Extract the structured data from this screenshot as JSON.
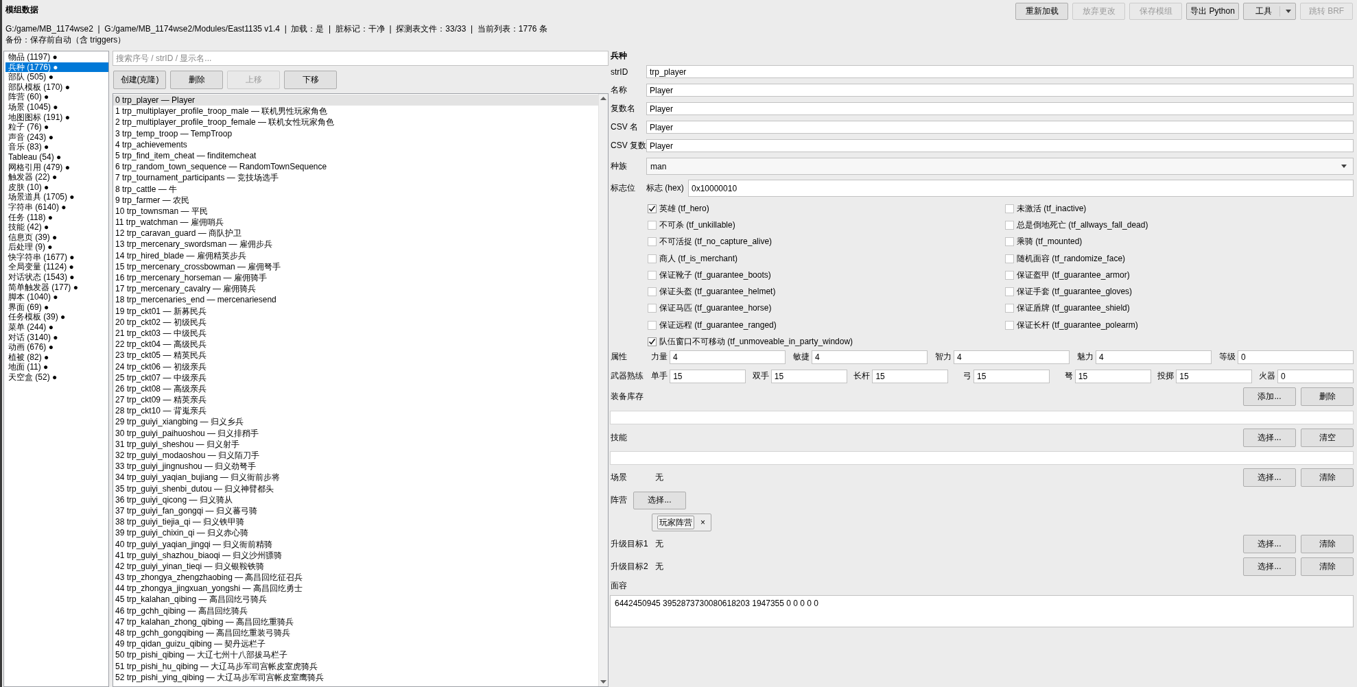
{
  "window": {
    "title": "模组数据",
    "path_info": "G:/game/MB_1174wse2  |  G:/game/MB_1174wse2/Modules/East1135 v1.4  |  加载：是  |  脏标记：干净  |  探测表文件：33/33  |  当前列表：1776 条",
    "backup_info": "备份：保存前自动（含 triggers）"
  },
  "toolbar": [
    {
      "kind": "button",
      "label": "重新加载",
      "disabled": false
    },
    {
      "kind": "button",
      "label": "放弃更改",
      "disabled": true
    },
    {
      "kind": "button",
      "label": "保存模组",
      "disabled": true
    },
    {
      "kind": "button",
      "label": "导出 Python",
      "disabled": false
    },
    {
      "kind": "menu",
      "label": "工具",
      "disabled": false
    },
    {
      "kind": "button",
      "label": "跳转 BRF",
      "disabled": true
    }
  ],
  "sidebar": {
    "items": [
      {
        "label": "物品 (1197) ●",
        "selected": false
      },
      {
        "label": "兵种 (1776) ●",
        "selected": true
      },
      {
        "label": "部队 (505) ●",
        "selected": false
      },
      {
        "label": "部队模板 (170) ●",
        "selected": false
      },
      {
        "label": "阵营 (60) ●",
        "selected": false
      },
      {
        "label": "场景 (1045) ●",
        "selected": false
      },
      {
        "label": "地图图标 (191) ●",
        "selected": false
      },
      {
        "label": "粒子 (76) ●",
        "selected": false
      },
      {
        "label": "声音 (243) ●",
        "selected": false
      },
      {
        "label": "音乐 (83) ●",
        "selected": false
      },
      {
        "label": "Tableau (54) ●",
        "selected": false
      },
      {
        "label": "网格引用 (479) ●",
        "selected": false
      },
      {
        "label": "触发器 (22) ●",
        "selected": false
      },
      {
        "label": "皮肤 (10) ●",
        "selected": false
      },
      {
        "label": "场景道具 (1705) ●",
        "selected": false
      },
      {
        "label": "字符串 (6140) ●",
        "selected": false
      },
      {
        "label": "任务 (118) ●",
        "selected": false
      },
      {
        "label": "技能 (42) ●",
        "selected": false
      },
      {
        "label": "信息页 (39) ●",
        "selected": false
      },
      {
        "label": "后处理 (9) ●",
        "selected": false
      },
      {
        "label": "快字符串 (1677) ●",
        "selected": false
      },
      {
        "label": "全局变量 (1124) ●",
        "selected": false
      },
      {
        "label": "对话状态 (1543) ●",
        "selected": false
      },
      {
        "label": "简单触发器 (177) ●",
        "selected": false
      },
      {
        "label": "脚本 (1040) ●",
        "selected": false
      },
      {
        "label": "界面 (69) ●",
        "selected": false
      },
      {
        "label": "任务模板 (39) ●",
        "selected": false
      },
      {
        "label": "菜单 (244) ●",
        "selected": false
      },
      {
        "label": "对话 (3140) ●",
        "selected": false
      },
      {
        "label": "动画 (676) ●",
        "selected": false
      },
      {
        "label": "植被 (82) ●",
        "selected": false
      },
      {
        "label": "地面 (11) ●",
        "selected": false
      },
      {
        "label": "天空盒 (52) ●",
        "selected": false
      }
    ]
  },
  "troop_list": {
    "search": {
      "placeholder": "搜索序号 / strID / 显示名..."
    },
    "buttons": [
      {
        "label": "创建(克隆)",
        "disabled": false
      },
      {
        "label": "删除",
        "disabled": false
      },
      {
        "label": "上移",
        "disabled": true
      },
      {
        "label": "下移",
        "disabled": false
      }
    ],
    "rows": [
      {
        "label": "0 trp_player — Player",
        "selected": true
      },
      {
        "label": "1 trp_multiplayer_profile_troop_male — 联机男性玩家角色",
        "selected": false
      },
      {
        "label": "2 trp_multiplayer_profile_troop_female — 联机女性玩家角色",
        "selected": false
      },
      {
        "label": "3 trp_temp_troop — TempTroop",
        "selected": false
      },
      {
        "label": "4 trp_achievements",
        "selected": false
      },
      {
        "label": "5 trp_find_item_cheat — finditemcheat",
        "selected": false
      },
      {
        "label": "6 trp_random_town_sequence — RandomTownSequence",
        "selected": false
      },
      {
        "label": "7 trp_tournament_participants — 竞技场选手",
        "selected": false
      },
      {
        "label": "8 trp_cattle — 牛",
        "selected": false
      },
      {
        "label": "9 trp_farmer — 农民",
        "selected": false
      },
      {
        "label": "10 trp_townsman — 平民",
        "selected": false
      },
      {
        "label": "11 trp_watchman — 雇佣哨兵",
        "selected": false
      },
      {
        "label": "12 trp_caravan_guard — 商队护卫",
        "selected": false
      },
      {
        "label": "13 trp_mercenary_swordsman — 雇佣步兵",
        "selected": false
      },
      {
        "label": "14 trp_hired_blade — 雇佣精英步兵",
        "selected": false
      },
      {
        "label": "15 trp_mercenary_crossbowman — 雇佣弩手",
        "selected": false
      },
      {
        "label": "16 trp_mercenary_horseman — 雇佣骑手",
        "selected": false
      },
      {
        "label": "17 trp_mercenary_cavalry — 雇佣骑兵",
        "selected": false
      },
      {
        "label": "18 trp_mercenaries_end — mercenariesend",
        "selected": false
      },
      {
        "label": "19 trp_ckt01 — 新募民兵",
        "selected": false
      },
      {
        "label": "20 trp_ckt02 — 初级民兵",
        "selected": false
      },
      {
        "label": "21 trp_ckt03 — 中级民兵",
        "selected": false
      },
      {
        "label": "22 trp_ckt04 — 高级民兵",
        "selected": false
      },
      {
        "label": "23 trp_ckt05 — 精英民兵",
        "selected": false
      },
      {
        "label": "24 trp_ckt06 — 初级亲兵",
        "selected": false
      },
      {
        "label": "25 trp_ckt07 — 中级亲兵",
        "selected": false
      },
      {
        "label": "26 trp_ckt08 — 高级亲兵",
        "selected": false
      },
      {
        "label": "27 trp_ckt09 — 精英亲兵",
        "selected": false
      },
      {
        "label": "28 trp_ckt10 — 背嵬亲兵",
        "selected": false
      },
      {
        "label": "29 trp_guiyi_xiangbing — 归义乡兵",
        "selected": false
      },
      {
        "label": "30 trp_guiyi_paihuoshou — 归义排矟手",
        "selected": false
      },
      {
        "label": "31 trp_guiyi_sheshou — 归义射手",
        "selected": false
      },
      {
        "label": "32 trp_guiyi_modaoshou — 归义陌刀手",
        "selected": false
      },
      {
        "label": "33 trp_guiyi_jingnushou — 归义劲弩手",
        "selected": false
      },
      {
        "label": "34 trp_guiyi_yaqian_bujiang — 归义衙前步将",
        "selected": false
      },
      {
        "label": "35 trp_guiyi_shenbi_dutou — 归义神臂都头",
        "selected": false
      },
      {
        "label": "36 trp_guiyi_qicong — 归义骑从",
        "selected": false
      },
      {
        "label": "37 trp_guiyi_fan_gongqi — 归义蕃弓骑",
        "selected": false
      },
      {
        "label": "38 trp_guiyi_tiejia_qi — 归义铁甲骑",
        "selected": false
      },
      {
        "label": "39 trp_guiyi_chixin_qi — 归义赤心骑",
        "selected": false
      },
      {
        "label": "40 trp_guiyi_yaqian_jingqi — 归义衙前精骑",
        "selected": false
      },
      {
        "label": "41 trp_guiyi_shazhou_biaoqi — 归义沙州骠骑",
        "selected": false
      },
      {
        "label": "42 trp_guiyi_yinan_tieqi — 归义银鞍铁骑",
        "selected": false
      },
      {
        "label": "43 trp_zhongya_zhengzhaobing — 高昌回纥征召兵",
        "selected": false
      },
      {
        "label": "44 trp_zhongya_jingxuan_yongshi — 高昌回纥勇士",
        "selected": false
      },
      {
        "label": "45 trp_kalahan_qibing — 高昌回纥弓骑兵",
        "selected": false
      },
      {
        "label": "46 trp_gchh_qibing — 高昌回纥骑兵",
        "selected": false
      },
      {
        "label": "47 trp_kalahan_zhong_qibing — 高昌回纥重骑兵",
        "selected": false
      },
      {
        "label": "48 trp_gchh_gongqibing — 高昌回纥重装弓骑兵",
        "selected": false
      },
      {
        "label": "49 trp_qidan_guizu_qibing — 契丹远栏子",
        "selected": false
      },
      {
        "label": "50 trp_pishi_qibing — 大辽七州十八部拔马栏子",
        "selected": false
      },
      {
        "label": "51 trp_pishi_hu_qibing — 大辽马步军司宫帐皮室虎骑兵",
        "selected": false
      },
      {
        "label": "52 trp_pishi_ying_qibing — 大辽马步军司宫帐皮室鹰骑兵",
        "selected": false
      }
    ]
  },
  "editor": {
    "title": "兵种",
    "fields": [
      {
        "kind": "text",
        "label": "strID",
        "value": "trp_player"
      },
      {
        "kind": "text",
        "label": "名称",
        "value": "Player"
      },
      {
        "kind": "text",
        "label": "复数名",
        "value": "Player"
      },
      {
        "kind": "text",
        "label": "CSV 名",
        "value": "Player"
      },
      {
        "kind": "text",
        "label": "CSV 复数",
        "value": "Player"
      },
      {
        "kind": "combo",
        "label": "种族",
        "value": "man"
      }
    ],
    "flags": {
      "label": "标志位",
      "hex_label": "标志 (hex)",
      "hex_value": "0x10000010",
      "items": [
        {
          "label": "英雄 (tf_hero)",
          "checked": true
        },
        {
          "label": "未激活 (tf_inactive)",
          "checked": false
        },
        {
          "label": "不可杀 (tf_unkillable)",
          "checked": false
        },
        {
          "label": "总是倒地死亡 (tf_allways_fall_dead)",
          "checked": false
        },
        {
          "label": "不可活捉 (tf_no_capture_alive)",
          "checked": false
        },
        {
          "label": "乘骑 (tf_mounted)",
          "checked": false
        },
        {
          "label": "商人 (tf_is_merchant)",
          "checked": false
        },
        {
          "label": "随机面容 (tf_randomize_face)",
          "checked": false
        },
        {
          "label": "保证靴子 (tf_guarantee_boots)",
          "checked": false
        },
        {
          "label": "保证盔甲 (tf_guarantee_armor)",
          "checked": false
        },
        {
          "label": "保证头盔 (tf_guarantee_helmet)",
          "checked": false
        },
        {
          "label": "保证手套 (tf_guarantee_gloves)",
          "checked": false
        },
        {
          "label": "保证马匹 (tf_guarantee_horse)",
          "checked": false
        },
        {
          "label": "保证盾牌 (tf_guarantee_shield)",
          "checked": false
        },
        {
          "label": "保证远程 (tf_guarantee_ranged)",
          "checked": false
        },
        {
          "label": "保证长杆 (tf_guarantee_polearm)",
          "checked": false
        },
        {
          "label": "队伍窗口不可移动 (tf_unmoveable_in_party_window)",
          "checked": true
        }
      ]
    },
    "attributes": {
      "label": "属性",
      "items": [
        {
          "label": "力量",
          "value": "4"
        },
        {
          "label": "敏捷",
          "value": "4"
        },
        {
          "label": "智力",
          "value": "4"
        },
        {
          "label": "魅力",
          "value": "4"
        },
        {
          "label": "等级",
          "value": "0"
        }
      ]
    },
    "proficiencies": {
      "label": "武器熟练",
      "items": [
        {
          "label": "单手",
          "value": "15"
        },
        {
          "label": "双手",
          "value": "15"
        },
        {
          "label": "长杆",
          "value": "15"
        },
        {
          "label": "弓",
          "value": "15"
        },
        {
          "label": "弩",
          "value": "15"
        },
        {
          "label": "投掷",
          "value": "15"
        },
        {
          "label": "火器",
          "value": "0"
        }
      ]
    },
    "inventory": {
      "label": "装备库存",
      "buttons": [
        "添加...",
        "删除"
      ]
    },
    "skills": {
      "label": "技能",
      "buttons": [
        "选择...",
        "清空"
      ]
    },
    "scene": {
      "label": "场景",
      "value": "无",
      "buttons": [
        "选择...",
        "清除"
      ]
    },
    "faction": {
      "label": "阵营",
      "button": "选择...",
      "tags": [
        {
          "label": "玩家阵营",
          "remove": "×"
        }
      ]
    },
    "upgrades": [
      {
        "label": "升级目标1",
        "value": "无",
        "buttons": [
          "选择...",
          "清除"
        ]
      },
      {
        "label": "升级目标2",
        "value": "无",
        "buttons": [
          "选择...",
          "清除"
        ]
      }
    ],
    "face": {
      "label": "面容",
      "value": "6442450945 3952873730080618203 1947355 0 0 0 0 0"
    }
  }
}
